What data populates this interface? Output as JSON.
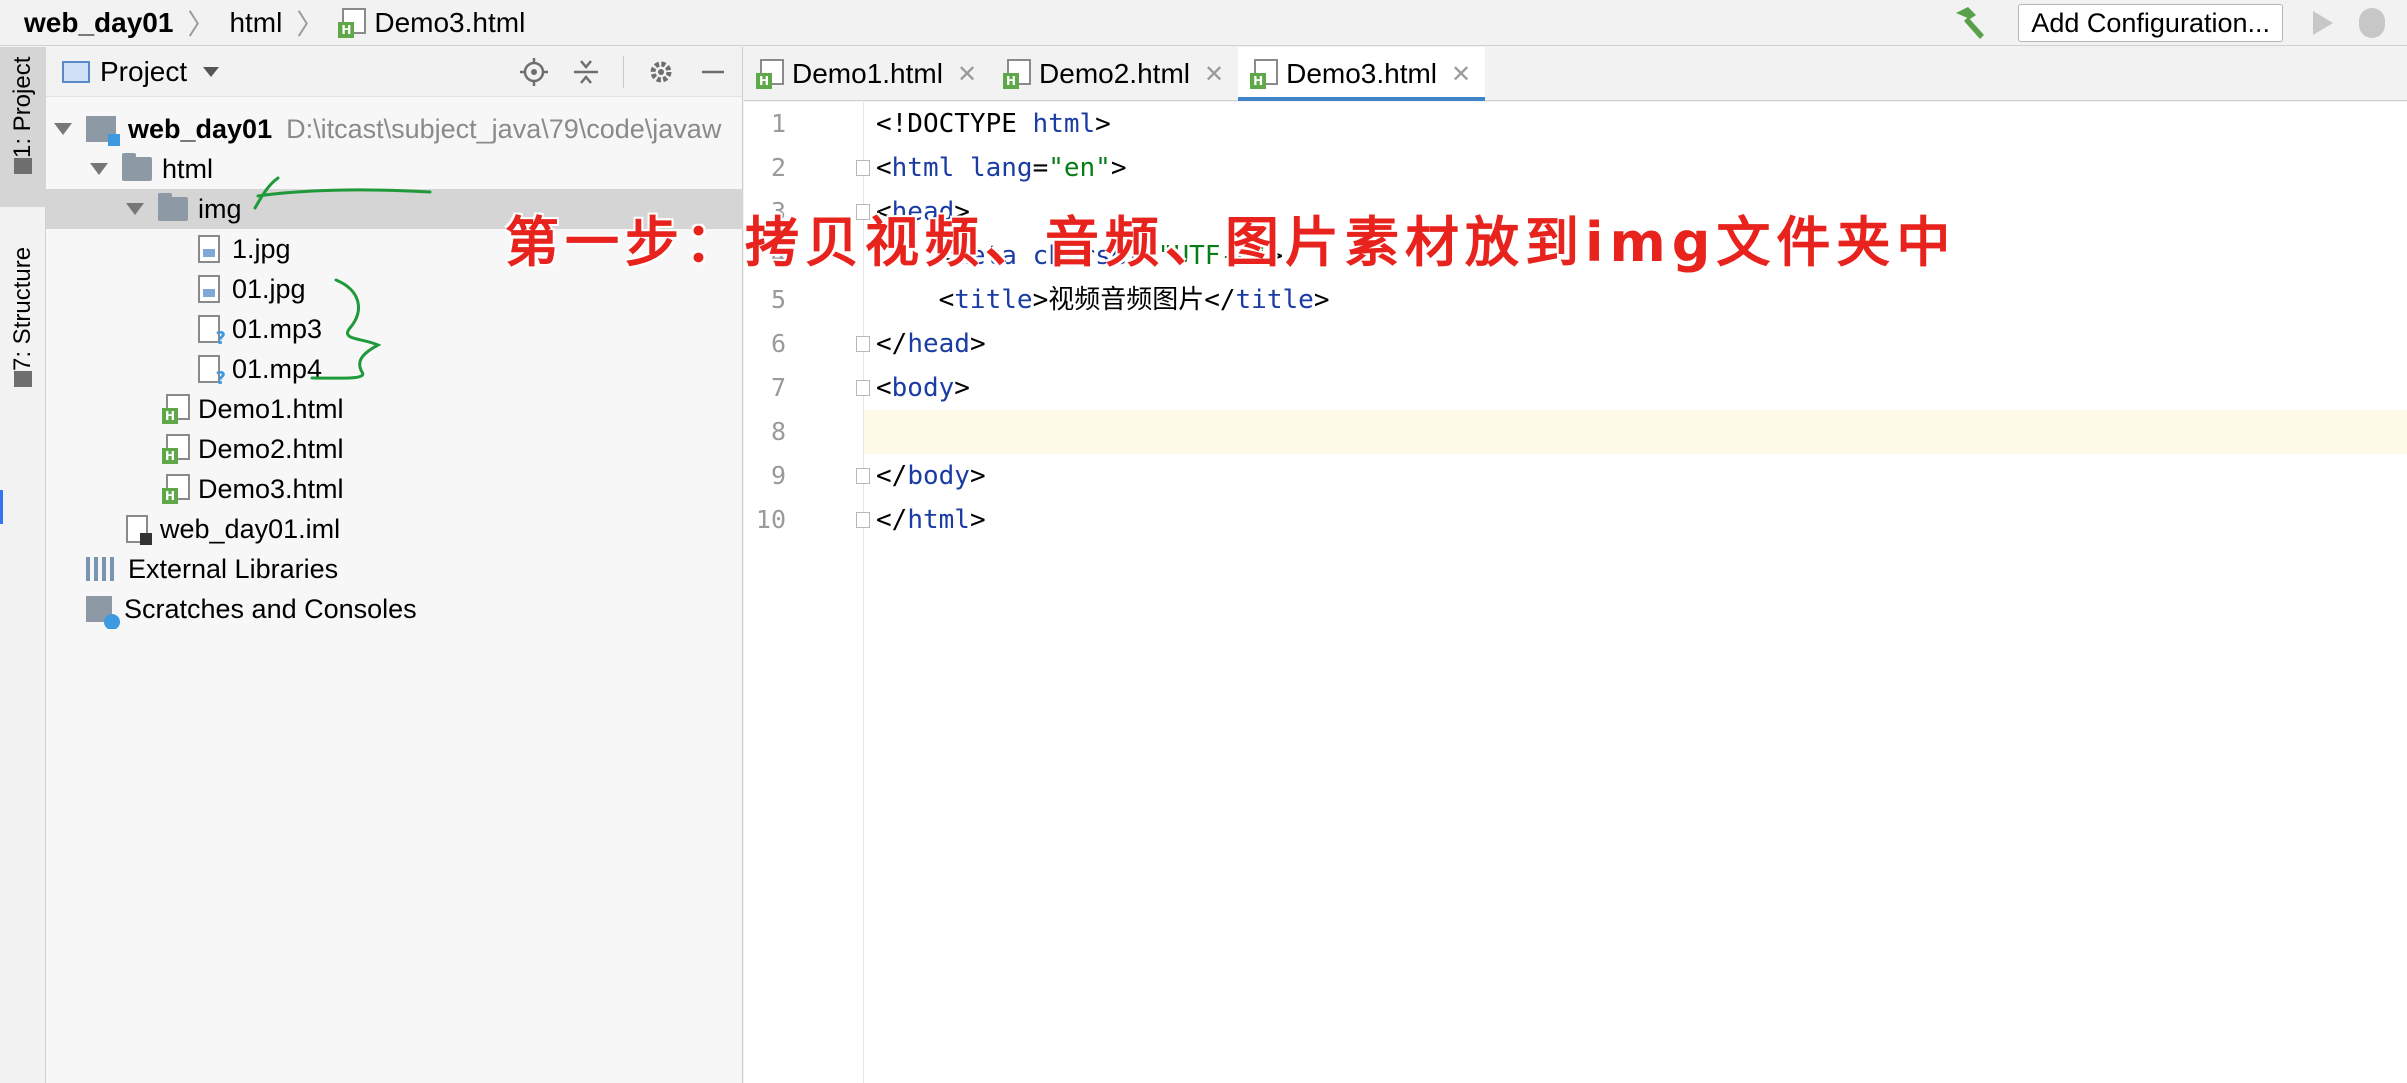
{
  "navbar": {
    "crumbs": [
      "web_day01",
      "html",
      "Demo3.html"
    ],
    "add_config_label": "Add Configuration...",
    "icons": [
      "hammer-icon",
      "run-icon",
      "debug-icon"
    ]
  },
  "toolstrip": {
    "project_tab": "1: Project",
    "structure_tab": "7: Structure"
  },
  "project": {
    "title": "Project",
    "tree": [
      {
        "label": "web_day01",
        "path": "D:\\itcast\\subject_java\\79\\code\\javaw",
        "type": "module"
      },
      {
        "label": "html",
        "type": "folder"
      },
      {
        "label": "img",
        "type": "folder",
        "selected": true
      },
      {
        "label": "1.jpg",
        "type": "image"
      },
      {
        "label": "01.jpg",
        "type": "image"
      },
      {
        "label": "01.mp3",
        "type": "unknown"
      },
      {
        "label": "01.mp4",
        "type": "unknown"
      },
      {
        "label": "Demo1.html",
        "type": "html"
      },
      {
        "label": "Demo2.html",
        "type": "html"
      },
      {
        "label": "Demo3.html",
        "type": "html"
      },
      {
        "label": "web_day01.iml",
        "type": "iml"
      },
      {
        "label": "External Libraries",
        "type": "extlib"
      },
      {
        "label": "Scratches and Consoles",
        "type": "scratch"
      }
    ]
  },
  "editor": {
    "tabs": [
      {
        "label": "Demo1.html",
        "active": false
      },
      {
        "label": "Demo2.html",
        "active": false
      },
      {
        "label": "Demo3.html",
        "active": true
      }
    ],
    "line_numbers": [
      "1",
      "2",
      "3",
      "4",
      "5",
      "6",
      "7",
      "8",
      "9",
      "10"
    ],
    "code": {
      "l1_a": "<!DOCTYPE ",
      "l1_b": "html",
      "l1_c": ">",
      "l2_a": "<",
      "l2_b": "html ",
      "l2_c": "lang",
      "l2_d": "=",
      "l2_e": "\"en\"",
      "l2_f": ">",
      "l3_a": "<",
      "l3_b": "head",
      "l3_c": ">",
      "l4_a": "    <",
      "l4_b": "meta ",
      "l4_c": "charset",
      "l4_d": "=",
      "l4_e": "\"UTF-8\"",
      "l4_f": ">",
      "l5_a": "    <",
      "l5_b": "title",
      "l5_c": ">视频音频图片</",
      "l5_d": "title",
      "l5_e": ">",
      "l6_a": "</",
      "l6_b": "head",
      "l6_c": ">",
      "l7_a": "<",
      "l7_b": "body",
      "l7_c": ">",
      "l9_a": "</",
      "l9_b": "body",
      "l9_c": ">",
      "l10_a": "</",
      "l10_b": "html",
      "l10_c": ">"
    }
  },
  "annotation": {
    "text": "第一步：拷贝视频、音频、图片素材放到img文件夹中",
    "color": "#e8231e"
  },
  "colors": {
    "tag": "#1a3ca3",
    "string": "#067d17",
    "active_tab_underline": "#4083c9",
    "pen_green": "#1f9a3a"
  }
}
